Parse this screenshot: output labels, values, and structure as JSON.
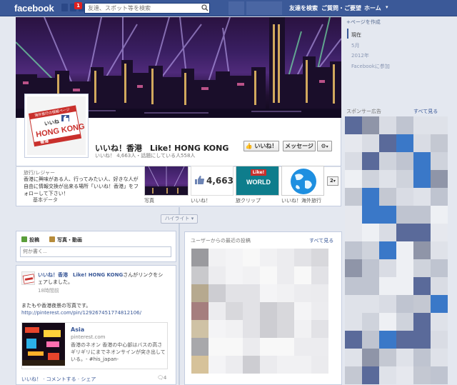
{
  "topbar": {
    "logo": "facebook",
    "notification_count": "1",
    "search_placeholder": "友達、スポット等を検索",
    "links": [
      "友達を検索",
      "ご質問・ご要望",
      "ホーム"
    ]
  },
  "page": {
    "name": "いいね！香港　Like! HONG KONG",
    "stats": "いいね！ 4,663人・話題にしている人558人",
    "like_button": "いいね！",
    "message_button": "メッセージ",
    "gear_button": "⚙",
    "profile_pic": {
      "banner_text": "海外旅行の情報ページ",
      "like_text": "いいね",
      "name_text": "HONG KONG",
      "sub_text": "香港"
    }
  },
  "about": {
    "category": "旅行/レジャー",
    "description": "香港に興味がある人、行ってみたい人、好きな人が自由に情報交換が出来る場所「いいね！香港」をフォローして下さい！",
    "basic_data": "基本データ",
    "more": "2"
  },
  "tiles": [
    {
      "label": "写真"
    },
    {
      "label": "いいね！",
      "count": "4,663"
    },
    {
      "label": "旅クリップ",
      "badge": "Like!",
      "word": "WORLD"
    },
    {
      "label": "いいね！海外旅行"
    }
  ],
  "timeline": {
    "highlight": "ハイライト"
  },
  "composer": {
    "tabs": [
      "投稿",
      "写真・動画"
    ],
    "placeholder": "何か書く..."
  },
  "post": {
    "author": "いいね！香港　Like! HONG KONG",
    "action": "さんがリンクをシェアしました。",
    "time": "18時間前",
    "text": "またもや香港夜景の写真です。",
    "url": "http://pinterest.com/pin/129267451774812106/",
    "link_title": "Asia",
    "link_domain": "pinterest.com",
    "link_desc": "香港のネオン 香港の中心部はバスの高さギリギリにまでネオンサインが突き出している。- #his_japan-",
    "actions": "いいね！ · コメントする · シェア",
    "comment_count": "4"
  },
  "recent": {
    "title": "ユーザーからの最近の投稿",
    "see_all": "すべて見る"
  },
  "right": {
    "create_page": "+ページを作成",
    "nav": [
      "現在",
      "5月",
      "2012年",
      "Facebookに参加"
    ],
    "sponsored": "スポンサー広告",
    "see_all": "すべて見る"
  },
  "colors": {
    "brand_blue": "#3b5998",
    "bg": "#e4e8f0",
    "link": "#3b5998"
  }
}
